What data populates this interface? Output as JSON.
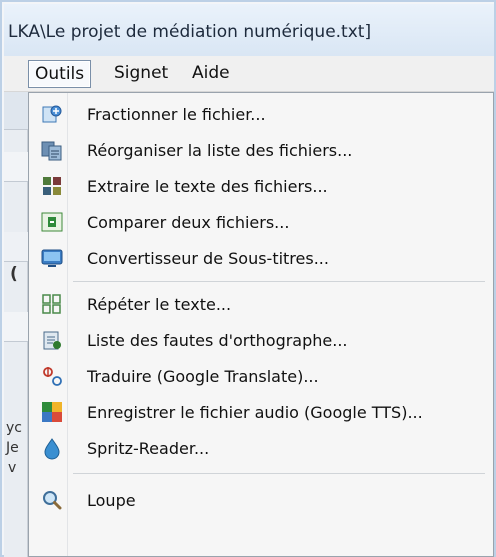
{
  "window": {
    "title": "LKA\\Le projet de médiation numérique.txt]"
  },
  "menubar": {
    "items": [
      {
        "label": "Outils",
        "active": true
      },
      {
        "label": "Signet",
        "active": false
      },
      {
        "label": "Aide",
        "active": false
      }
    ]
  },
  "menu": {
    "items": [
      {
        "label": "Fractionner le fichier...",
        "icon": "split-file-icon"
      },
      {
        "label": "Réorganiser la liste des fichiers...",
        "icon": "reorder-files-icon"
      },
      {
        "label": "Extraire le texte des fichiers...",
        "icon": "extract-text-icon"
      },
      {
        "label": "Comparer deux fichiers...",
        "icon": "compare-files-icon"
      },
      {
        "label": "Convertisseur de Sous-titres...",
        "icon": "subtitle-converter-icon"
      },
      {
        "label": "Répéter le texte...",
        "icon": "repeat-text-icon"
      },
      {
        "label": "Liste des fautes d'orthographe...",
        "icon": "spelling-list-icon"
      },
      {
        "label": "Traduire (Google Translate)...",
        "icon": "translate-icon"
      },
      {
        "label": "Enregistrer le fichier audio (Google TTS)...",
        "icon": "record-audio-icon"
      },
      {
        "label": "Spritz-Reader...",
        "icon": "drop-icon"
      },
      {
        "label": "Loupe",
        "icon": "magnifier-icon"
      }
    ]
  },
  "background_fragments": {
    "a": "(",
    "b": "yc",
    "c": "Je",
    "d": "v"
  },
  "colors": {
    "menu_bg": "#f6f6f6",
    "title_bg": "#dde9f6",
    "frame_border": "#bcd0e6"
  }
}
